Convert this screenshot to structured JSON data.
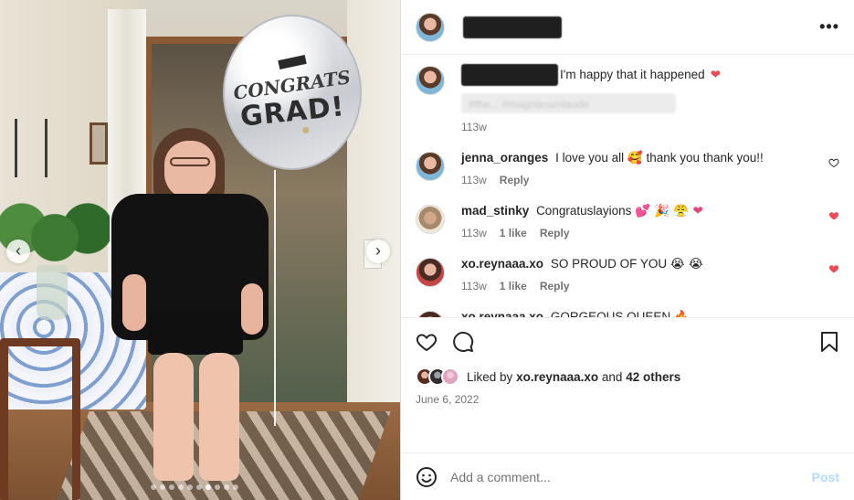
{
  "post": {
    "photo": {
      "balloon_line1": "CONGRATS",
      "balloon_line2": "GRAD!",
      "nav_prev": "‹",
      "nav_next": "›",
      "carousel_total": 10,
      "carousel_active": 7
    },
    "header": {
      "avatar_icon": "profile-avatar",
      "more_icon": "more-options-icon",
      "more_label": "•••"
    },
    "caption": {
      "text": "I'm happy that it happened",
      "emoji": "❤",
      "hashtags": "#the... #magnacumlaude",
      "time": "113w"
    },
    "comments": [
      {
        "user": "jenna_oranges",
        "text": "I love you all",
        "emoji": "🥰",
        "text2": "thank you thank you!!",
        "time": "113w",
        "likes": "",
        "reply": "Reply",
        "liked": false
      },
      {
        "user": "mad_stinky",
        "text": "Congratuslayions",
        "emoji": "💕 🎉 😤 ❤",
        "text2": "",
        "time": "113w",
        "likes": "1 like",
        "reply": "Reply",
        "liked": true
      },
      {
        "user": "xo.reynaaa.xo",
        "text": "SO PROUD OF YOU",
        "emoji": "😭 😭",
        "text2": "",
        "time": "113w",
        "likes": "1 like",
        "reply": "Reply",
        "liked": true
      },
      {
        "user": "xo.reynaaa.xo",
        "text": "GORGEOUS QUEEN",
        "emoji": "🔥",
        "text2": "",
        "time": "",
        "likes": "",
        "reply": "",
        "liked": true
      }
    ],
    "actions": {
      "like_icon": "heart-icon",
      "comment_icon": "comment-icon",
      "save_icon": "bookmark-icon"
    },
    "likes": {
      "prefix": "Liked by",
      "user": "xo.reynaaa.xo",
      "middle": "and",
      "others": "42 others"
    },
    "date": "June 6, 2022",
    "add_comment": {
      "placeholder": "Add a comment...",
      "post_label": "Post",
      "emoji_icon": "smiley-icon"
    },
    "colors": {
      "like_red": "#ed4956",
      "post_disabled": "#b3dbff",
      "meta_gray": "#737373"
    }
  }
}
